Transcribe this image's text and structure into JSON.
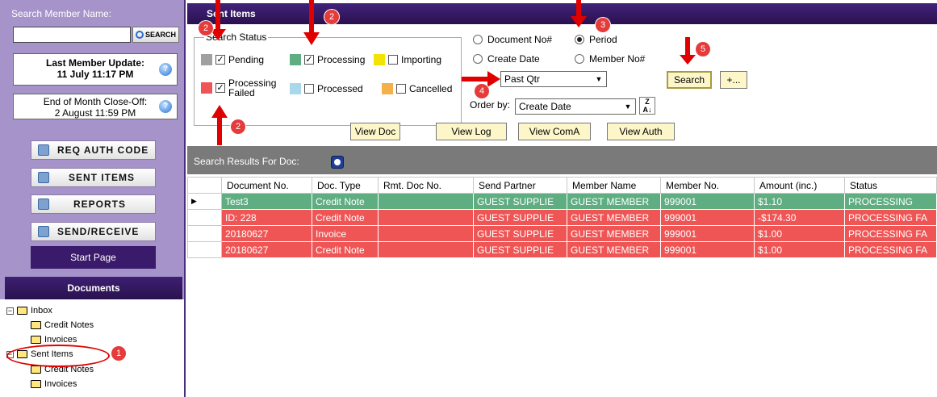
{
  "sidebar": {
    "search_label": "Search Member Name:",
    "search_button": "SEARCH",
    "last_update_title": "Last Member Update:",
    "last_update_value": "11 July 11:17 PM",
    "eom_title": "End of Month Close-Off:",
    "eom_value": "2 August 11:59 PM",
    "nav": {
      "req_auth": "REQ AUTH CODE",
      "sent_items": "SENT ITEMS",
      "reports": "REPORTS",
      "send_receive": "SEND/RECEIVE",
      "start_page": "Start Page"
    },
    "documents_header": "Documents",
    "tree": {
      "inbox": "Inbox",
      "inbox_credit": "Credit Notes",
      "inbox_invoices": "Invoices",
      "sent": "Sent Items",
      "sent_credit": "Credit Notes",
      "sent_invoices": "Invoices"
    }
  },
  "main": {
    "title": "Sent Items",
    "status_legend": "Search Status",
    "status": {
      "pending": "Pending",
      "processing": "Processing",
      "importing": "Importing",
      "failed_line1": "Processing",
      "failed_line2": "Failed",
      "processed": "Processed",
      "cancelled": "Cancelled"
    },
    "radios": {
      "document_no": "Document No#",
      "period": "Period",
      "create_date": "Create Date",
      "member_no": "Member No#"
    },
    "period_value": "Past Qtr",
    "order_label": "Order by:",
    "order_value": "Create Date",
    "buttons": {
      "search": "Search",
      "more": "+...",
      "view_doc": "View Doc",
      "view_log": "View Log",
      "view_coma": "View ComA",
      "view_auth": "View Auth"
    },
    "results_label": "Search Results For Doc:",
    "columns": [
      "Document No.",
      "Doc. Type",
      "Rmt. Doc No.",
      "Send Partner",
      "Member Name",
      "Member No.",
      "Amount (inc.)",
      "Status"
    ],
    "rows": [
      [
        "Test3",
        "Credit Note",
        "",
        "GUEST SUPPLIE",
        "GUEST MEMBER",
        "999001",
        "$1.10",
        "PROCESSING"
      ],
      [
        "ID: 228",
        "Credit Note",
        "",
        "GUEST SUPPLIE",
        "GUEST MEMBER",
        "999001",
        "-$174.30",
        "PROCESSING FA"
      ],
      [
        "20180627",
        "Invoice",
        "",
        "GUEST SUPPLIE",
        "GUEST MEMBER",
        "999001",
        "$1.00",
        "PROCESSING FA"
      ],
      [
        "20180627",
        "Credit Note",
        "",
        "GUEST SUPPLIE",
        "GUEST MEMBER",
        "999001",
        "$1.00",
        "PROCESSING FA"
      ]
    ]
  },
  "annotations": {
    "b1": "1",
    "b2a": "2",
    "b2b": "2",
    "b2c": "2",
    "b3": "3",
    "b4": "4",
    "b5": "5"
  },
  "colors": {
    "pending": "#a0a0a0",
    "processing": "#5fae82",
    "importing": "#f2e400",
    "failed": "#ef5555",
    "processed": "#a9d8ec",
    "cancelled": "#f5b04a"
  }
}
